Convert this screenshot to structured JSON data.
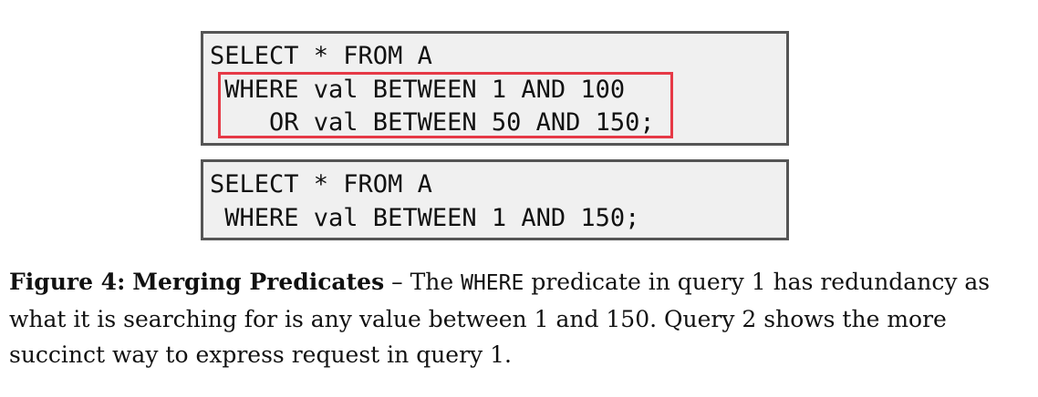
{
  "query1": {
    "lines": [
      "SELECT * FROM A",
      " WHERE val BETWEEN 1 AND 100",
      "    OR val BETWEEN 50 AND 150;"
    ]
  },
  "query2": {
    "lines": [
      "SELECT * FROM A",
      " WHERE val BETWEEN 1 AND 150;"
    ]
  },
  "caption": {
    "label": "Figure 4:",
    "title": "Merging Predicates",
    "dash": "–",
    "text_before": "The",
    "code_word": "WHERE",
    "text_after": "predicate in query 1 has redundancy as what it is searching for is any value between 1 and 150. Query 2 shows the more succinct way to express request in query 1."
  },
  "colors": {
    "highlight_border": "#e63946",
    "box_border": "#555555",
    "box_background": "#f0f0f0"
  }
}
